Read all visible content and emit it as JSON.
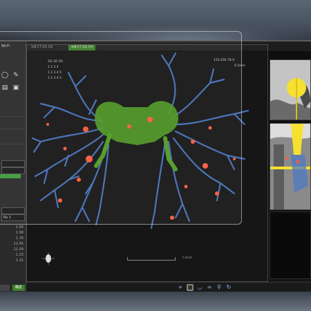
{
  "left_panel": {
    "title": "Wi-Fi",
    "rows": [
      "",
      "",
      ""
    ],
    "boxes": [
      "",
      "",
      "",
      "Ru 1"
    ],
    "numbers": [
      "1.56",
      "1.98",
      "1.76",
      "12.45",
      "11.09",
      "1.23",
      "1.31"
    ],
    "buttons": [
      "",
      "确定"
    ]
  },
  "viewport": {
    "tabs": [
      "1/8  CT  1/1 CH",
      "1/8  CT  1/1 CH"
    ],
    "overlay_top_left": [
      "2D  3D  3D",
      "1  2  3  4",
      "1  2  3  4  5",
      "1  2  3  4  5"
    ],
    "overlay_top_right": [
      "123.456  78.9",
      "0.5mm"
    ],
    "scale_label": "5.0cm"
  },
  "colors": {
    "accent": "#3e7e2c",
    "airway": "#4a78c8",
    "trachea": "#4e9a24",
    "nodule": "#ff5a3c",
    "highlight": "#f6e030"
  },
  "bottom_icons": [
    "plus-icon",
    "square-icon",
    "lung-icon",
    "link-icon",
    "zoom-icon",
    "rotate-icon"
  ]
}
